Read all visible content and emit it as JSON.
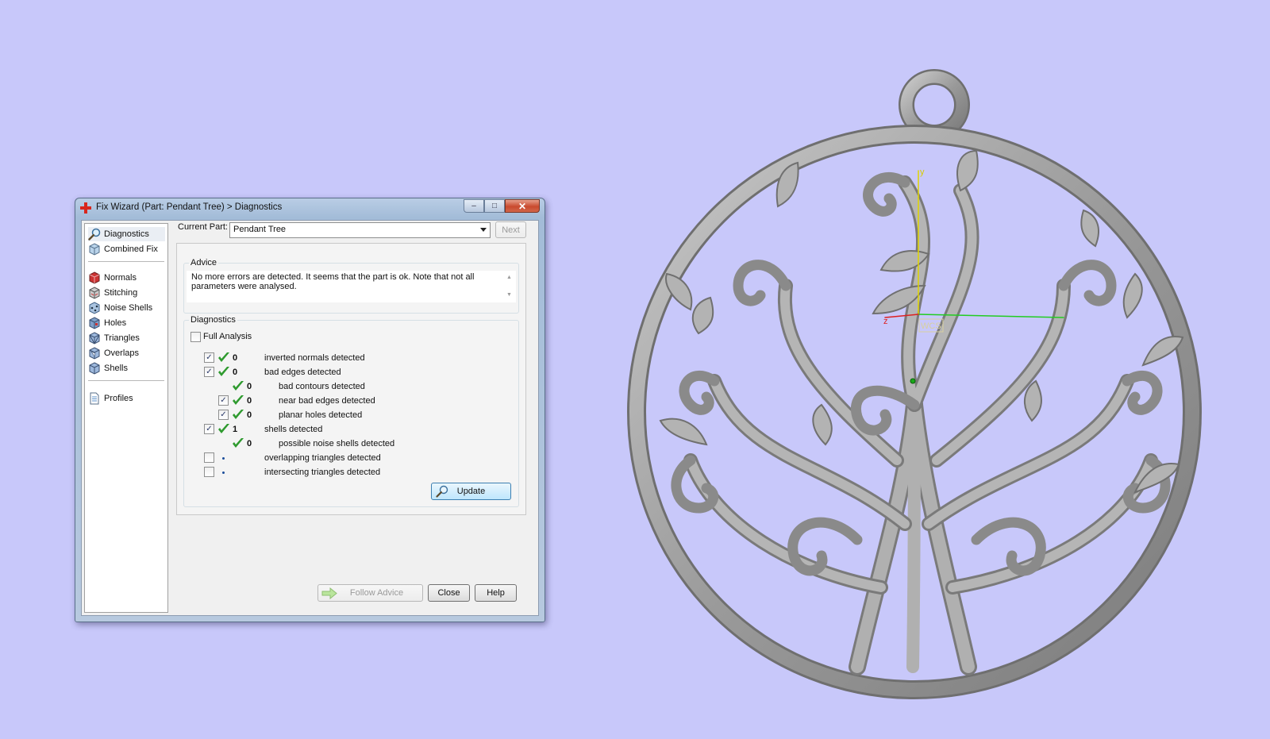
{
  "window": {
    "title": "Fix Wizard (Part: Pendant Tree) > Diagnostics",
    "caption_minimize": "–",
    "caption_maximize": "□",
    "caption_close": "✕"
  },
  "nav": {
    "top_items": [
      {
        "label": "Diagnostics",
        "icon": "magnifier-icon"
      },
      {
        "label": "Combined Fix",
        "icon": "cube-icon"
      }
    ],
    "tool_items": [
      {
        "label": "Normals",
        "icon": "normals-cube-icon"
      },
      {
        "label": "Stitching",
        "icon": "stitching-cube-icon"
      },
      {
        "label": "Noise Shells",
        "icon": "noise-shells-cube-icon"
      },
      {
        "label": "Holes",
        "icon": "holes-cube-icon"
      },
      {
        "label": "Triangles",
        "icon": "triangles-cube-icon"
      },
      {
        "label": "Overlaps",
        "icon": "overlaps-cube-icon"
      },
      {
        "label": "Shells",
        "icon": "shells-cube-icon"
      }
    ],
    "bottom_items": [
      {
        "label": "Profiles",
        "icon": "document-icon"
      }
    ]
  },
  "current_part": {
    "label": "Current Part:",
    "value": "Pendant Tree",
    "next_label": "Next"
  },
  "advice": {
    "title": "Advice",
    "text": "No more errors are detected. It seems that the part is ok. Note that not all parameters were analysed."
  },
  "diagnostics": {
    "title": "Diagnostics",
    "full_analysis_label": "Full Analysis",
    "full_analysis_checked": false,
    "rows": [
      {
        "checked": true,
        "has_checkbox": true,
        "ok": true,
        "count": "0",
        "label": "inverted normals detected",
        "indent": 0
      },
      {
        "checked": true,
        "has_checkbox": true,
        "ok": true,
        "count": "0",
        "label": "bad edges detected",
        "indent": 0
      },
      {
        "checked": false,
        "has_checkbox": false,
        "ok": true,
        "count": "0",
        "label": "bad contours detected",
        "indent": 1
      },
      {
        "checked": true,
        "has_checkbox": true,
        "ok": true,
        "count": "0",
        "label": "near bad edges detected",
        "indent": 1
      },
      {
        "checked": true,
        "has_checkbox": true,
        "ok": true,
        "count": "0",
        "label": "planar holes detected",
        "indent": 1
      },
      {
        "checked": true,
        "has_checkbox": true,
        "ok": true,
        "count": "1",
        "label": "shells detected",
        "indent": 0
      },
      {
        "checked": false,
        "has_checkbox": false,
        "ok": true,
        "count": "0",
        "label": "possible noise shells detected",
        "indent": 1
      },
      {
        "checked": false,
        "has_checkbox": true,
        "ok": false,
        "count": "",
        "label": "overlapping triangles detected",
        "indent": 0
      },
      {
        "checked": false,
        "has_checkbox": true,
        "ok": false,
        "count": "",
        "label": "intersecting triangles detected",
        "indent": 0
      }
    ],
    "update_label": "Update"
  },
  "footer": {
    "follow_advice_label": "Follow Advice",
    "close_label": "Close",
    "help_label": "Help"
  },
  "viewport": {
    "axis_z_label": "z",
    "axis_y_label": "y",
    "wcs_label": "WCS",
    "background_color": "#c8c8fa",
    "model_color": "#a9a9a9"
  }
}
